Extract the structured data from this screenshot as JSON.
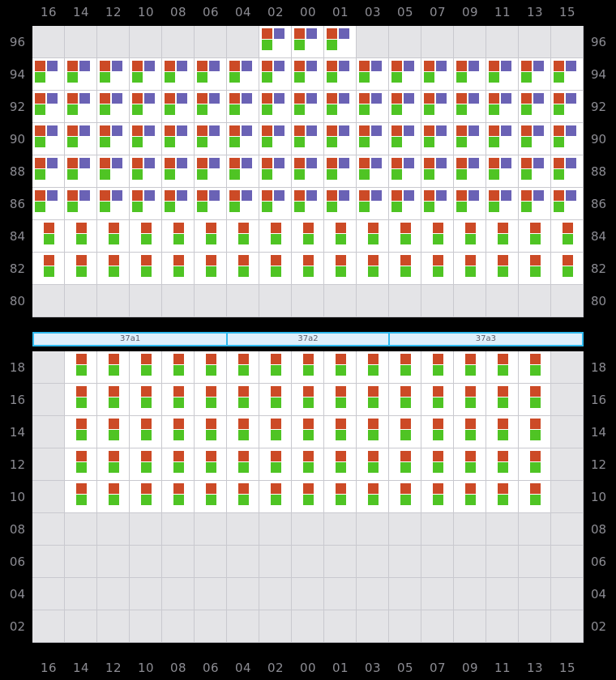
{
  "chart_data": {
    "type": "heatmap",
    "title": "",
    "xlabel": "",
    "ylabel": "",
    "grid": true,
    "legend_position": "none",
    "colors": {
      "red": "#cc4a26",
      "purple": "#6a62b5",
      "green": "#4fc424",
      "empty_cell": "#e4e4e7",
      "filled_cell": "#ffffff",
      "grid_line": "#c9c9cf",
      "axis_text": "#8c8c93",
      "background": "#000000",
      "segment_fill": "#deeffb",
      "segment_border": "#2fb9ee"
    },
    "x_categories": [
      "16",
      "14",
      "12",
      "10",
      "08",
      "06",
      "04",
      "02",
      "00",
      "01",
      "03",
      "05",
      "07",
      "09",
      "11",
      "13",
      "15"
    ],
    "panels": [
      {
        "name": "top-panel",
        "y_categories": [
          "96",
          "94",
          "92",
          "90",
          "88",
          "86",
          "84",
          "82",
          "80"
        ],
        "rows": [
          {
            "y": "96",
            "markers": [
              "",
              "",
              "",
              "",
              "",
              "",
              "",
              "rpg",
              "rpg",
              "rpg",
              "",
              "",
              "",
              "",
              "",
              "",
              ""
            ]
          },
          {
            "y": "94",
            "markers": [
              "rpg",
              "rpg",
              "rpg",
              "rpg",
              "rpg",
              "rpg",
              "rpg",
              "rpg",
              "rpg",
              "rpg",
              "rpg",
              "rpg",
              "rpg",
              "rpg",
              "rpg",
              "rpg",
              "rpg"
            ]
          },
          {
            "y": "92",
            "markers": [
              "rpg",
              "rpg",
              "rpg",
              "rpg",
              "rpg",
              "rpg",
              "rpg",
              "rpg",
              "rpg",
              "rpg",
              "rpg",
              "rpg",
              "rpg",
              "rpg",
              "rpg",
              "rpg",
              "rpg"
            ]
          },
          {
            "y": "90",
            "markers": [
              "rpg",
              "rpg",
              "rpg",
              "rpg",
              "rpg",
              "rpg",
              "rpg",
              "rpg",
              "rpg",
              "rpg",
              "rpg",
              "rpg",
              "rpg",
              "rpg",
              "rpg",
              "rpg",
              "rpg"
            ]
          },
          {
            "y": "88",
            "markers": [
              "rpg",
              "rpg",
              "rpg",
              "rpg",
              "rpg",
              "rpg",
              "rpg",
              "rpg",
              "rpg",
              "rpg",
              "rpg",
              "rpg",
              "rpg",
              "rpg",
              "rpg",
              "rpg",
              "rpg"
            ]
          },
          {
            "y": "86",
            "markers": [
              "rpg",
              "rpg",
              "rpg",
              "rpg",
              "rpg",
              "rpg",
              "rpg",
              "rpg",
              "rpg",
              "rpg",
              "rpg",
              "rpg",
              "rpg",
              "rpg",
              "rpg",
              "rpg",
              "rpg"
            ]
          },
          {
            "y": "84",
            "markers": [
              "rg",
              "rg",
              "rg",
              "rg",
              "rg",
              "rg",
              "rg",
              "rg",
              "rg",
              "rg",
              "rg",
              "rg",
              "rg",
              "rg",
              "rg",
              "rg",
              "rg"
            ]
          },
          {
            "y": "82",
            "markers": [
              "rg",
              "rg",
              "rg",
              "rg",
              "rg",
              "rg",
              "rg",
              "rg",
              "rg",
              "rg",
              "rg",
              "rg",
              "rg",
              "rg",
              "rg",
              "rg",
              "rg"
            ]
          },
          {
            "y": "80",
            "markers": [
              "",
              "",
              "",
              "",
              "",
              "",
              "",
              "",
              "",
              "",
              "",
              "",
              "",
              "",
              "",
              "",
              ""
            ]
          }
        ]
      },
      {
        "name": "bottom-panel",
        "y_categories": [
          "18",
          "16",
          "14",
          "12",
          "10",
          "08",
          "06",
          "04",
          "02"
        ],
        "rows": [
          {
            "y": "18",
            "markers": [
              "",
              "rg",
              "rg",
              "rg",
              "rg",
              "rg",
              "rg",
              "rg",
              "rg",
              "rg",
              "rg",
              "rg",
              "rg",
              "rg",
              "rg",
              "rg",
              ""
            ]
          },
          {
            "y": "16",
            "markers": [
              "",
              "rg",
              "rg",
              "rg",
              "rg",
              "rg",
              "rg",
              "rg",
              "rg",
              "rg",
              "rg",
              "rg",
              "rg",
              "rg",
              "rg",
              "rg",
              ""
            ]
          },
          {
            "y": "14",
            "markers": [
              "",
              "rg",
              "rg",
              "rg",
              "rg",
              "rg",
              "rg",
              "rg",
              "rg",
              "rg",
              "rg",
              "rg",
              "rg",
              "rg",
              "rg",
              "rg",
              ""
            ]
          },
          {
            "y": "12",
            "markers": [
              "",
              "rg",
              "rg",
              "rg",
              "rg",
              "rg",
              "rg",
              "rg",
              "rg",
              "rg",
              "rg",
              "rg",
              "rg",
              "rg",
              "rg",
              "rg",
              ""
            ]
          },
          {
            "y": "10",
            "markers": [
              "",
              "rg",
              "rg",
              "rg",
              "rg",
              "rg",
              "rg",
              "rg",
              "rg",
              "rg",
              "rg",
              "rg",
              "rg",
              "rg",
              "rg",
              "rg",
              ""
            ]
          },
          {
            "y": "08",
            "markers": [
              "",
              "",
              "",
              "",
              "",
              "",
              "",
              "",
              "",
              "",
              "",
              "",
              "",
              "",
              "",
              "",
              ""
            ]
          },
          {
            "y": "06",
            "markers": [
              "",
              "",
              "",
              "",
              "",
              "",
              "",
              "",
              "",
              "",
              "",
              "",
              "",
              "",
              "",
              "",
              ""
            ]
          },
          {
            "y": "04",
            "markers": [
              "",
              "",
              "",
              "",
              "",
              "",
              "",
              "",
              "",
              "",
              "",
              "",
              "",
              "",
              "",
              "",
              ""
            ]
          },
          {
            "y": "02",
            "markers": [
              "",
              "",
              "",
              "",
              "",
              "",
              "",
              "",
              "",
              "",
              "",
              "",
              "",
              "",
              "",
              "",
              ""
            ]
          }
        ]
      }
    ],
    "segments": [
      {
        "label": "37a1",
        "span": 6
      },
      {
        "label": "37a2",
        "span": 5
      },
      {
        "label": "37a3",
        "span": 6
      }
    ]
  }
}
